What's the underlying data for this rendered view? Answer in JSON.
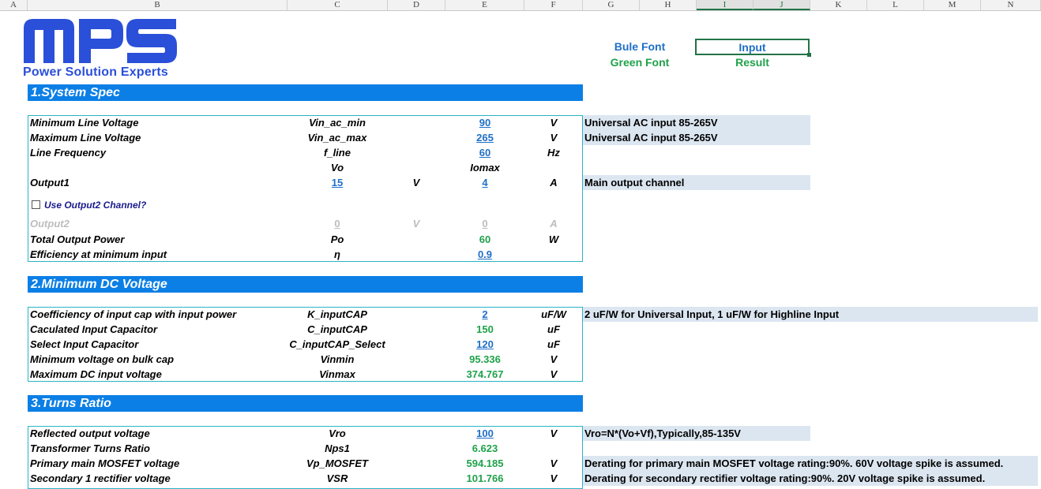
{
  "columns": [
    "A",
    "B",
    "C",
    "D",
    "E",
    "F",
    "G",
    "H",
    "I",
    "J",
    "K",
    "L",
    "M",
    "N"
  ],
  "logo": {
    "text": "MPS",
    "tagline": "Power Solution Experts"
  },
  "legend": {
    "blue_font": "Bule Font",
    "green_font": "Green Font",
    "input": "Input",
    "result": "Result"
  },
  "colors": {
    "section_bg": "#0b7fe6",
    "input_blue": "#1f6fc7",
    "result_green": "#1fa24a",
    "note_bg": "#dce6f1",
    "box_border": "#2bb3c6"
  },
  "sections": {
    "s1": "1.System Spec",
    "s2": "2.Minimum DC Voltage",
    "s3": "3.Turns Ratio"
  },
  "system_spec": {
    "min_line": {
      "label": "Minimum Line Voltage",
      "symbol": "Vin_ac_min",
      "value": "90",
      "unit": "V",
      "note": "Universal AC input 85-265V"
    },
    "max_line": {
      "label": "Maximum Line Voltage",
      "symbol": "Vin_ac_max",
      "value": "265",
      "unit": "V",
      "note": "Universal AC input 85-265V"
    },
    "freq": {
      "label": "Line Frequency",
      "symbol": "f_line",
      "value": "60",
      "unit": "Hz"
    },
    "header": {
      "vo": "Vo",
      "iomax": "Iomax"
    },
    "output1": {
      "label": "Output1",
      "vo": "15",
      "vo_unit": "V",
      "io": "4",
      "io_unit": "A",
      "note": "Main output channel"
    },
    "checkbox": {
      "label": "Use Output2 Channel?",
      "checked": false
    },
    "output2": {
      "label": "Output2",
      "vo": "0",
      "vo_unit": "V",
      "io": "0",
      "io_unit": "A"
    },
    "total_power": {
      "label": "Total Output Power",
      "symbol": "Po",
      "value": "60",
      "unit": "W"
    },
    "efficiency": {
      "label": "Efficiency at minimum input",
      "symbol": "η",
      "value": "0.9"
    }
  },
  "min_dc": {
    "k_cap": {
      "label": "Coefficiency of input cap with input power",
      "symbol": "K_inputCAP",
      "value": "2",
      "unit": "uF/W",
      "note": "2 uF/W for Universal Input, 1 uF/W for Highline Input"
    },
    "calc_cap": {
      "label": "Caculated Input Capacitor",
      "symbol": "C_inputCAP",
      "value": "150",
      "unit": "uF"
    },
    "sel_cap": {
      "label": "Select Input Capacitor",
      "symbol": "C_inputCAP_Select",
      "value": "120",
      "unit": "uF"
    },
    "vinmin": {
      "label": "Minimum voltage on bulk cap",
      "symbol": "Vinmin",
      "value": "95.336",
      "unit": "V"
    },
    "vinmax": {
      "label": "Maximum DC input voltage",
      "symbol": "Vinmax",
      "value": "374.767",
      "unit": "V"
    }
  },
  "turns": {
    "vro": {
      "label": "Reflected output voltage",
      "symbol": "Vro",
      "value": "100",
      "unit": "V",
      "note": "Vro=N*(Vo+Vf),Typically,85-135V"
    },
    "nps": {
      "label": "Transformer Turns Ratio",
      "symbol": "Nps1",
      "value": "6.623"
    },
    "vp": {
      "label": "Primary main MOSFET voltage",
      "symbol": "Vp_MOSFET",
      "value": "594.185",
      "unit": "V",
      "note": "Derating for primary main MOSFET voltage rating:90%. 60V voltage spike is assumed."
    },
    "vsr": {
      "label": "Secondary 1 rectifier voltage",
      "symbol": "VSR",
      "value": "101.766",
      "unit": "V",
      "note": "Derating for secondary rectifier voltage rating:90%. 20V voltage spike is assumed."
    }
  }
}
